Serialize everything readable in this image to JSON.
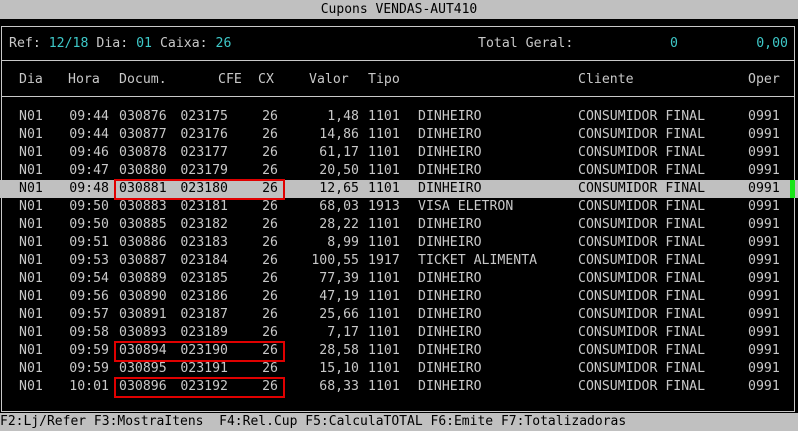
{
  "window": {
    "title": "Cupons VENDAS-AUT410"
  },
  "summary": {
    "ref_label": "Ref:",
    "ref_value": "12/18",
    "dia_label": "Dia:",
    "dia_value": "01",
    "caixa_label": "Caixa:",
    "caixa_value": "26",
    "total_label": "Total Geral:",
    "total_count": "0",
    "total_value": "0,00"
  },
  "columns": {
    "dia": "Dia",
    "hora": "Hora",
    "docum": "Docum.",
    "cfe": "CFE",
    "cx": "CX",
    "valor": "Valor",
    "tipo": "Tipo",
    "cliente": "Cliente",
    "oper": "Oper"
  },
  "rows": [
    {
      "dia": "N01",
      "hora": "09:44",
      "docum": "030876",
      "cfe": "023175",
      "cx": "26",
      "valor": "1,48",
      "tipo": "1101",
      "desc": "DINHEIRO",
      "cliente": "CONSUMIDOR FINAL",
      "oper": "0991"
    },
    {
      "dia": "N01",
      "hora": "09:44",
      "docum": "030877",
      "cfe": "023176",
      "cx": "26",
      "valor": "14,86",
      "tipo": "1101",
      "desc": "DINHEIRO",
      "cliente": "CONSUMIDOR FINAL",
      "oper": "0991"
    },
    {
      "dia": "N01",
      "hora": "09:46",
      "docum": "030878",
      "cfe": "023177",
      "cx": "26",
      "valor": "61,17",
      "tipo": "1101",
      "desc": "DINHEIRO",
      "cliente": "CONSUMIDOR FINAL",
      "oper": "0991"
    },
    {
      "dia": "N01",
      "hora": "09:47",
      "docum": "030880",
      "cfe": "023179",
      "cx": "26",
      "valor": "20,50",
      "tipo": "1101",
      "desc": "DINHEIRO",
      "cliente": "CONSUMIDOR FINAL",
      "oper": "0991"
    },
    {
      "dia": "N01",
      "hora": "09:48",
      "docum": "030881",
      "cfe": "023180",
      "cx": "26",
      "valor": "12,65",
      "tipo": "1101",
      "desc": "DINHEIRO",
      "cliente": "CONSUMIDOR FINAL",
      "oper": "0991"
    },
    {
      "dia": "N01",
      "hora": "09:50",
      "docum": "030883",
      "cfe": "023181",
      "cx": "26",
      "valor": "68,03",
      "tipo": "1913",
      "desc": "VISA ELETRON",
      "cliente": "CONSUMIDOR FINAL",
      "oper": "0991"
    },
    {
      "dia": "N01",
      "hora": "09:50",
      "docum": "030885",
      "cfe": "023182",
      "cx": "26",
      "valor": "28,22",
      "tipo": "1101",
      "desc": "DINHEIRO",
      "cliente": "CONSUMIDOR FINAL",
      "oper": "0991"
    },
    {
      "dia": "N01",
      "hora": "09:51",
      "docum": "030886",
      "cfe": "023183",
      "cx": "26",
      "valor": "8,99",
      "tipo": "1101",
      "desc": "DINHEIRO",
      "cliente": "CONSUMIDOR FINAL",
      "oper": "0991"
    },
    {
      "dia": "N01",
      "hora": "09:53",
      "docum": "030887",
      "cfe": "023184",
      "cx": "26",
      "valor": "100,55",
      "tipo": "1917",
      "desc": "TICKET ALIMENTA",
      "cliente": "CONSUMIDOR FINAL",
      "oper": "0991"
    },
    {
      "dia": "N01",
      "hora": "09:54",
      "docum": "030889",
      "cfe": "023185",
      "cx": "26",
      "valor": "77,39",
      "tipo": "1101",
      "desc": "DINHEIRO",
      "cliente": "CONSUMIDOR FINAL",
      "oper": "0991"
    },
    {
      "dia": "N01",
      "hora": "09:56",
      "docum": "030890",
      "cfe": "023186",
      "cx": "26",
      "valor": "47,19",
      "tipo": "1101",
      "desc": "DINHEIRO",
      "cliente": "CONSUMIDOR FINAL",
      "oper": "0991"
    },
    {
      "dia": "N01",
      "hora": "09:57",
      "docum": "030891",
      "cfe": "023187",
      "cx": "26",
      "valor": "25,66",
      "tipo": "1101",
      "desc": "DINHEIRO",
      "cliente": "CONSUMIDOR FINAL",
      "oper": "0991"
    },
    {
      "dia": "N01",
      "hora": "09:58",
      "docum": "030893",
      "cfe": "023189",
      "cx": "26",
      "valor": "7,17",
      "tipo": "1101",
      "desc": "DINHEIRO",
      "cliente": "CONSUMIDOR FINAL",
      "oper": "0991"
    },
    {
      "dia": "N01",
      "hora": "09:59",
      "docum": "030894",
      "cfe": "023190",
      "cx": "26",
      "valor": "28,58",
      "tipo": "1101",
      "desc": "DINHEIRO",
      "cliente": "CONSUMIDOR FINAL",
      "oper": "0991"
    },
    {
      "dia": "N01",
      "hora": "09:59",
      "docum": "030895",
      "cfe": "023191",
      "cx": "26",
      "valor": "15,10",
      "tipo": "1101",
      "desc": "DINHEIRO",
      "cliente": "CONSUMIDOR FINAL",
      "oper": "0991"
    },
    {
      "dia": "N01",
      "hora": "10:01",
      "docum": "030896",
      "cfe": "023192",
      "cx": "26",
      "valor": "68,33",
      "tipo": "1101",
      "desc": "DINHEIRO",
      "cliente": "CONSUMIDOR FINAL",
      "oper": "0991"
    }
  ],
  "selected_row": 4,
  "highlighted_rows": [
    4,
    13,
    15
  ],
  "colors": {
    "accent_cyan": "#3ec8c8",
    "highlight_red": "#e00000",
    "scroll_green": "#19e619",
    "selection_gray": "#c0c0c0"
  },
  "footer": {
    "f2": "F2:Lj/Refer",
    "f3": "F3:MostraItens",
    "f4": "F4:Rel.Cup",
    "f5": "F5:CalculaTOTAL",
    "f6": "F6:Emite",
    "f7": "F7:Totalizadoras"
  }
}
